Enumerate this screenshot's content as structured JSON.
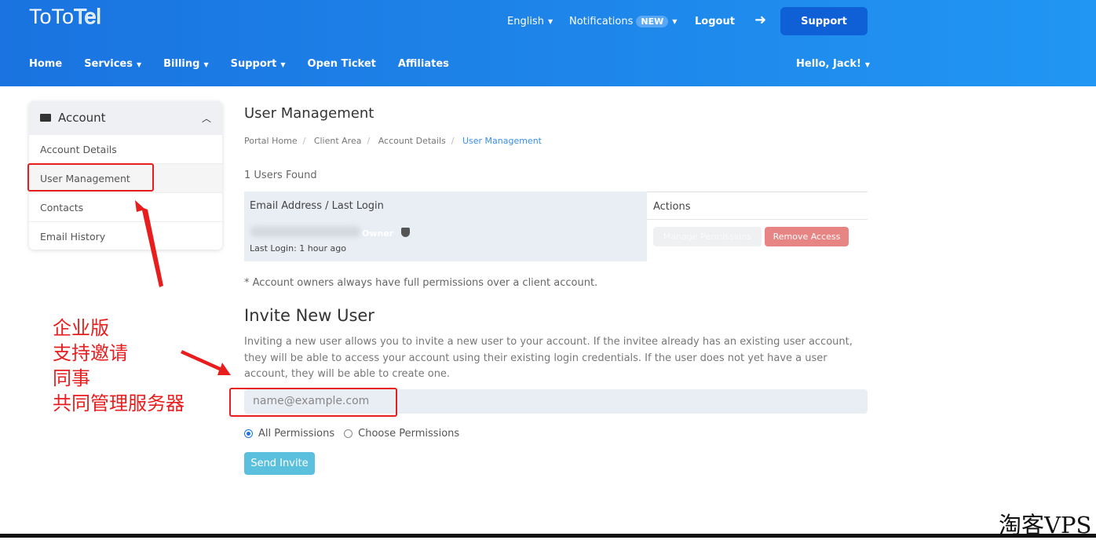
{
  "brand": {
    "logo_main": "ToTo",
    "logo_accent": "Tel"
  },
  "topbar": {
    "language": "English",
    "notifications": "Notifications",
    "new_badge": "NEW",
    "logout": "Logout",
    "support_button": "Support"
  },
  "nav": {
    "items": [
      "Home",
      "Services",
      "Billing",
      "Support",
      "Open Ticket",
      "Affiliates"
    ],
    "user_greeting": "Hello, Jack!"
  },
  "sidebar": {
    "title": "Account",
    "items": [
      "Account Details",
      "User Management",
      "Contacts",
      "Email History"
    ]
  },
  "page": {
    "title": "User Management",
    "breadcrumb": [
      "Portal Home",
      "Client Area",
      "Account Details",
      "User Management"
    ],
    "users_found": "1 Users Found"
  },
  "table": {
    "headers": [
      "Email Address / Last Login",
      "Actions"
    ],
    "rows": [
      {
        "role": "Owner",
        "last_login": "Last Login: 1 hour ago",
        "manage": "Manage Permissions",
        "remove": "Remove Access"
      }
    ]
  },
  "note": "* Account owners always have full permissions over a client account.",
  "invite": {
    "title": "Invite New User",
    "description": "Inviting a new user allows you to invite a new user to your account. If the invitee already has an existing user account, they will be able to access your account using their existing login credentials. If the user does not yet have a user account, they will be able to create one.",
    "placeholder": "name@example.com",
    "options": [
      "All Permissions",
      "Choose Permissions"
    ],
    "selected": "All Permissions",
    "send": "Send Invite"
  },
  "annotation": {
    "lines": [
      "企业版",
      "支持邀请",
      "同事",
      "共同管理服务器"
    ],
    "color": "#e81d1d"
  },
  "watermark": "淘客VPS"
}
